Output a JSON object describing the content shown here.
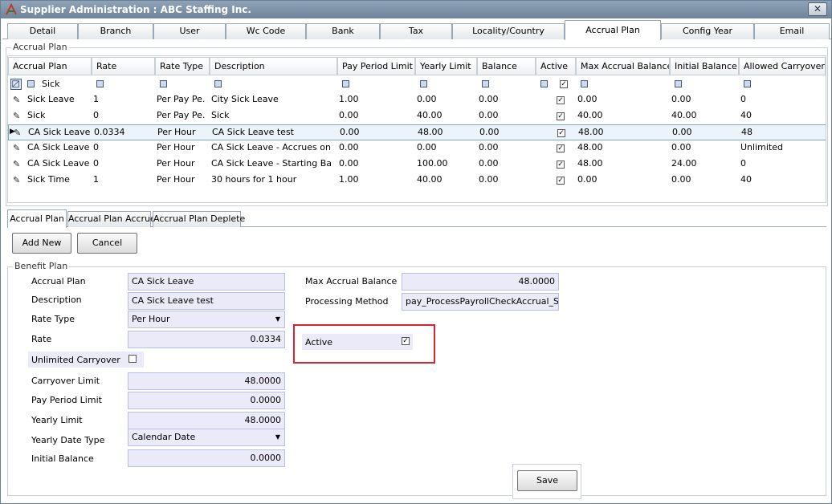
{
  "window": {
    "title": "Supplier Administration : ABC Staffing Inc.",
    "close_glyph": "✕"
  },
  "top_tabs": [
    "Detail",
    "Branch",
    "User",
    "Wc Code",
    "Bank",
    "Tax",
    "Locality/Country",
    "Accrual Plan",
    "Config Year",
    "Email"
  ],
  "accrual_group": {
    "title": "Accrual Plan"
  },
  "grid": {
    "columns": [
      "Accrual Plan",
      "Rate",
      "Rate Type",
      "Description",
      "Pay Period Limit",
      "Yearly Limit",
      "Balance",
      "Active",
      "Max Accrual Balance",
      "Initial Balance",
      "Allowed Carryover"
    ],
    "filter_text": "Sick",
    "rows": [
      [
        "Sick Leave",
        "1",
        "Per Pay Pe...",
        "City Sick Leave",
        "1.00",
        "0.00",
        "0.00",
        true,
        "0.00",
        "0.00",
        "0"
      ],
      [
        "Sick",
        "0",
        "Per Pay Pe...",
        "Sick",
        "0.00",
        "40.00",
        "0.00",
        true,
        "40.00",
        "40.00",
        "40"
      ],
      [
        "CA Sick Leave",
        "0.0334",
        "Per Hour",
        "CA Sick Leave test",
        "0.00",
        "48.00",
        "0.00",
        true,
        "48.00",
        "0.00",
        "48"
      ],
      [
        "CA Sick Leave...",
        "0",
        "Per Hour",
        "CA Sick Leave - Accrues on h...",
        "0.00",
        "0.00",
        "0.00",
        true,
        "48.00",
        "0.00",
        "Unlimited"
      ],
      [
        "CA Sick Leave...",
        "0",
        "Per Hour",
        "CA Sick Leave - Starting Bala...",
        "0.00",
        "100.00",
        "0.00",
        true,
        "48.00",
        "24.00",
        "0"
      ],
      [
        "Sick Time",
        "1",
        "Per Hour",
        "30 hours for 1 hour",
        "1.00",
        "40.00",
        "0.00",
        true,
        "0.00",
        "0.00",
        "40"
      ]
    ]
  },
  "sub_tabs": [
    "Accrual  Plan",
    "Accrual Plan Accrue",
    "Accrual Plan Deplete"
  ],
  "buttons": {
    "add_new": "Add New",
    "cancel": "Cancel",
    "save": "Save"
  },
  "benefit": {
    "title": "Benefit Plan",
    "accrual_plan_label": "Accrual Plan",
    "accrual_plan_value": "CA Sick Leave",
    "description_label": "Description",
    "description_value": "CA Sick Leave test",
    "rate_type_label": "Rate Type",
    "rate_type_value": "Per Hour",
    "rate_label": "Rate",
    "rate_value": "0.0334",
    "unlimited_carryover_label": "Unlimited Carryover",
    "unlimited_carryover_checked": false,
    "carryover_limit_label": "Carryover Limit",
    "carryover_limit_value": "48.0000",
    "pay_period_limit_label": "Pay Period Limit",
    "pay_period_limit_value": "0.0000",
    "yearly_limit_label": "Yearly Limit",
    "yearly_limit_value": "48.0000",
    "yearly_date_type_label": "Yearly Date Type",
    "yearly_date_type_value": "Calendar Date",
    "initial_balance_label": "Initial Balance",
    "initial_balance_value": "0.0000",
    "max_accrual_balance_label": "Max Accrual Balance",
    "max_accrual_balance_value": "48.0000",
    "processing_method_label": "Processing Method",
    "processing_method_value": "pay_ProcessPayrollCheckAccrual_SickI",
    "active_label": "Active",
    "active_checked": true
  },
  "colors": {
    "highlight": "#d9232e",
    "field_bg": "#ebeaf9",
    "selected_row": "#eaf4fa"
  }
}
